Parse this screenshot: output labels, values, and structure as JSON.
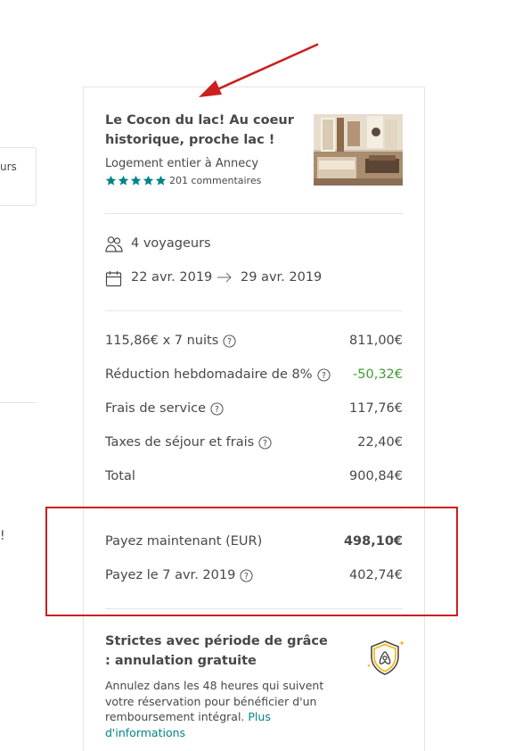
{
  "left": {
    "box_text": "urs",
    "exclamation": "!"
  },
  "listing": {
    "title": "Le Cocon du lac! Au coeur historique, proche lac !",
    "subtitle": "Logement entier à Annecy",
    "stars": 5,
    "reviews": "201 commentaires",
    "accent_color": "#008489"
  },
  "trip": {
    "guests": "4 voyageurs",
    "date_start": "22 avr. 2019",
    "date_end": "29 avr. 2019"
  },
  "prices": {
    "rows": [
      {
        "label": "115,86€ x 7 nuits",
        "value": "811,00€",
        "help": true
      },
      {
        "label": "Réduction hebdomadaire de 8%",
        "value": "-50,32€",
        "help": true
      },
      {
        "label": "Frais de service",
        "value": "117,76€",
        "help": true
      },
      {
        "label": "Taxes de séjour et frais",
        "value": "22,40€",
        "help": true
      },
      {
        "label": "Total",
        "value": "900,84€",
        "help": false
      }
    ],
    "discount_color": "#3f9b2e"
  },
  "payment": {
    "now_label": "Payez maintenant (EUR)",
    "now_value": "498,10€",
    "later_label": "Payez le 7 avr. 2019",
    "later_value": "402,74€"
  },
  "policy": {
    "title": "Strictes avec période de grâce : annulation gratuite",
    "text": "Annulez dans les 48 heures qui suivent votre réservation pour bénéficier d'un remboursement intégral. ",
    "link": "Plus d'informations"
  },
  "annotation_color": "#cc1f1f"
}
